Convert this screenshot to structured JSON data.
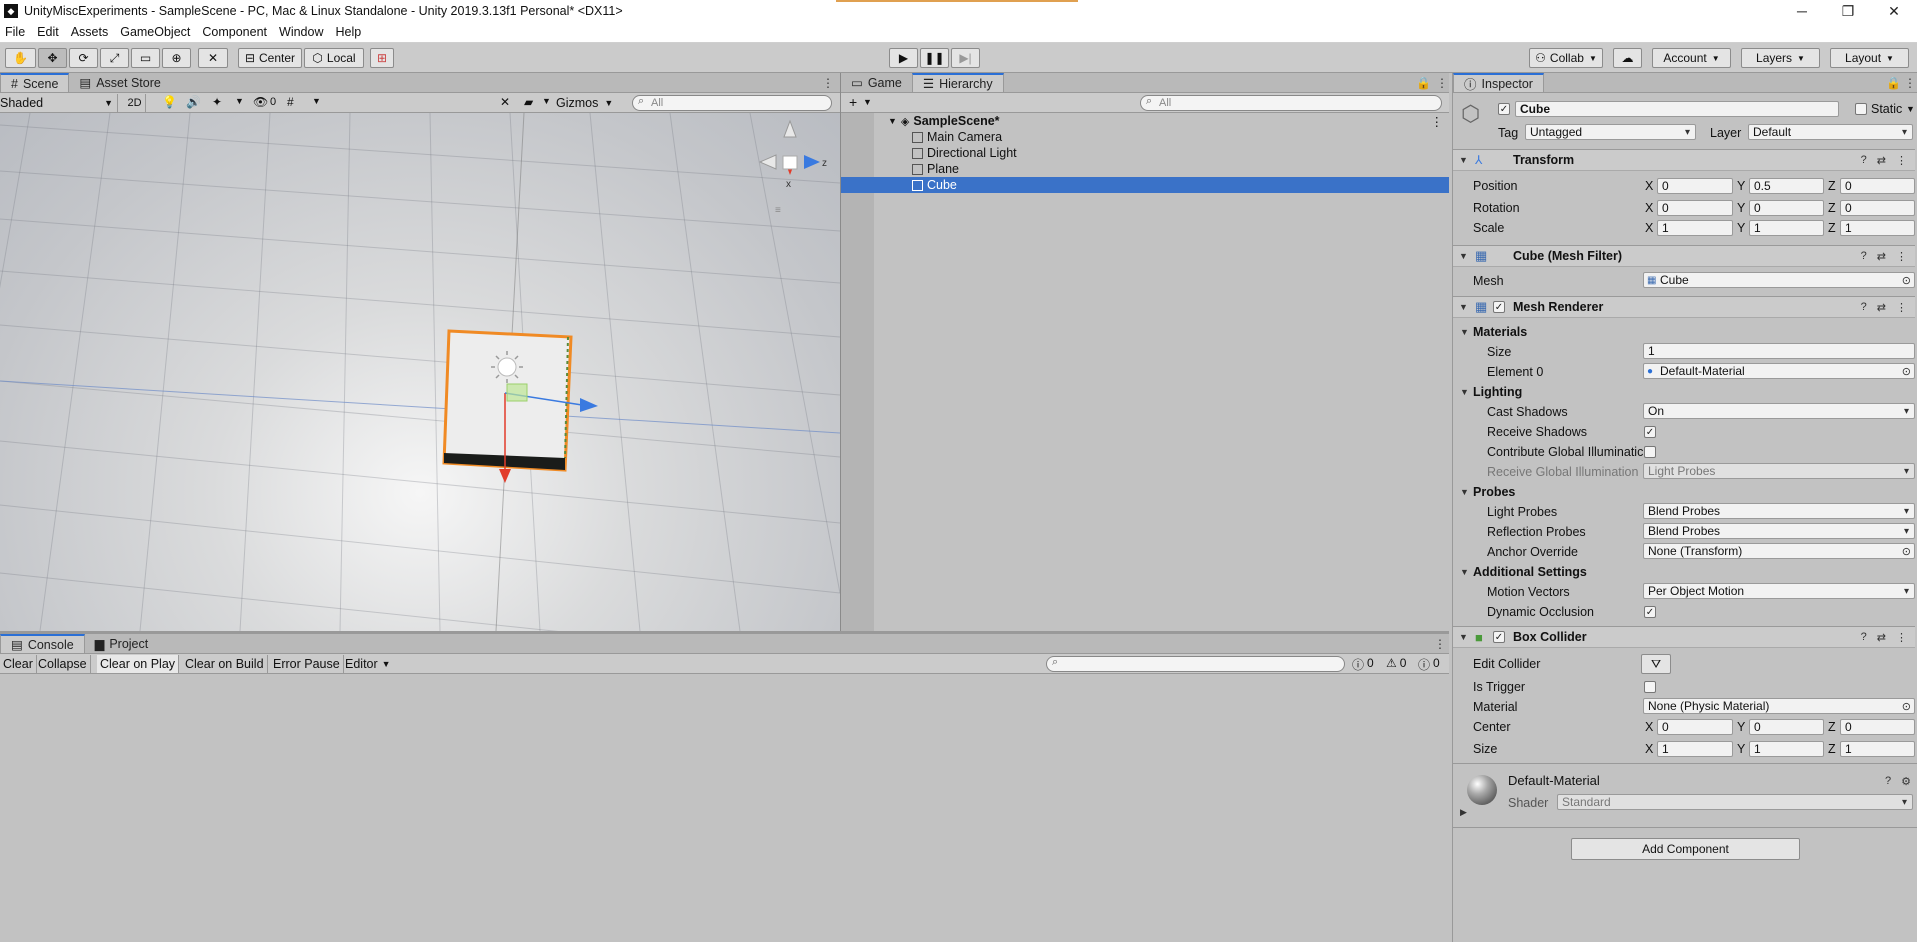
{
  "window": {
    "title": "UnityMiscExperiments - SampleScene - PC, Mac & Linux Standalone - Unity 2019.3.13f1 Personal* <DX11>",
    "minimize": "─",
    "maximize": "❐",
    "close": "✕"
  },
  "menu": [
    "File",
    "Edit",
    "Assets",
    "GameObject",
    "Component",
    "Window",
    "Help"
  ],
  "toolbar": {
    "pivot_mode": "Center",
    "pivot_rotation": "Local",
    "collab": "Collab",
    "account": "Account",
    "layers": "Layers",
    "layout": "Layout"
  },
  "scene_panel": {
    "tabs": [
      "Scene",
      "Asset Store"
    ],
    "shading": "Shaded",
    "mode_2d": "2D",
    "hidden_count": "0",
    "gizmos": "Gizmos",
    "search_placeholder": "All",
    "gizmo_axis_z": "z",
    "gizmo_axis_x": "x",
    "colors": {
      "selection": "#f08a24",
      "x_axis": "#e23c2a",
      "z_axis": "#3a7ae0"
    }
  },
  "hierarchy": {
    "tabs": [
      "Game",
      "Hierarchy"
    ],
    "search_placeholder": "All",
    "scene_name": "SampleScene*",
    "items": [
      "Main Camera",
      "Directional Light",
      "Plane",
      "Cube"
    ],
    "selected": "Cube",
    "selection_color": "#3a72c8"
  },
  "console": {
    "tabs": [
      "Console",
      "Project"
    ],
    "buttons": [
      "Clear",
      "Collapse",
      "Clear on Play",
      "Clear on Build",
      "Error Pause",
      "Editor"
    ],
    "log_count": "0",
    "warn_count": "0",
    "error_count": "0"
  },
  "inspector": {
    "tab": "Inspector",
    "object_name": "Cube",
    "static_label": "Static",
    "tag_label": "Tag",
    "tag_value": "Untagged",
    "layer_label": "Layer",
    "layer_value": "Default",
    "transform": {
      "title": "Transform",
      "position_label": "Position",
      "position": [
        "0",
        "0.5",
        "0"
      ],
      "rotation_label": "Rotation",
      "rotation": [
        "0",
        "0",
        "0"
      ],
      "scale_label": "Scale",
      "scale": [
        "1",
        "1",
        "1"
      ],
      "axis": [
        "X",
        "Y",
        "Z"
      ]
    },
    "mesh_filter": {
      "title": "Cube (Mesh Filter)",
      "mesh_label": "Mesh",
      "mesh_value": "Cube"
    },
    "mesh_renderer": {
      "title": "Mesh Renderer",
      "materials": "Materials",
      "size_label": "Size",
      "size_value": "1",
      "element0_label": "Element 0",
      "element0_value": "Default-Material",
      "lighting": "Lighting",
      "cast_shadows_label": "Cast Shadows",
      "cast_shadows_value": "On",
      "receive_shadows_label": "Receive Shadows",
      "contribute_gi_label": "Contribute Global Illuminatic",
      "receive_gi_label": "Receive Global Illumination",
      "receive_gi_value": "Light Probes",
      "probes": "Probes",
      "light_probes_label": "Light Probes",
      "light_probes_value": "Blend Probes",
      "reflection_probes_label": "Reflection Probes",
      "reflection_probes_value": "Blend Probes",
      "anchor_label": "Anchor Override",
      "anchor_value": "None (Transform)",
      "additional": "Additional Settings",
      "motion_label": "Motion Vectors",
      "motion_value": "Per Object Motion",
      "dynamic_label": "Dynamic Occlusion"
    },
    "box_collider": {
      "title": "Box Collider",
      "edit_label": "Edit Collider",
      "trigger_label": "Is Trigger",
      "material_label": "Material",
      "material_value": "None (Physic Material)",
      "center_label": "Center",
      "center": [
        "0",
        "0",
        "0"
      ],
      "size_label": "Size",
      "size": [
        "1",
        "1",
        "1"
      ]
    },
    "material": {
      "name": "Default-Material",
      "shader_label": "Shader",
      "shader_value": "Standard"
    },
    "add_component": "Add Component"
  }
}
